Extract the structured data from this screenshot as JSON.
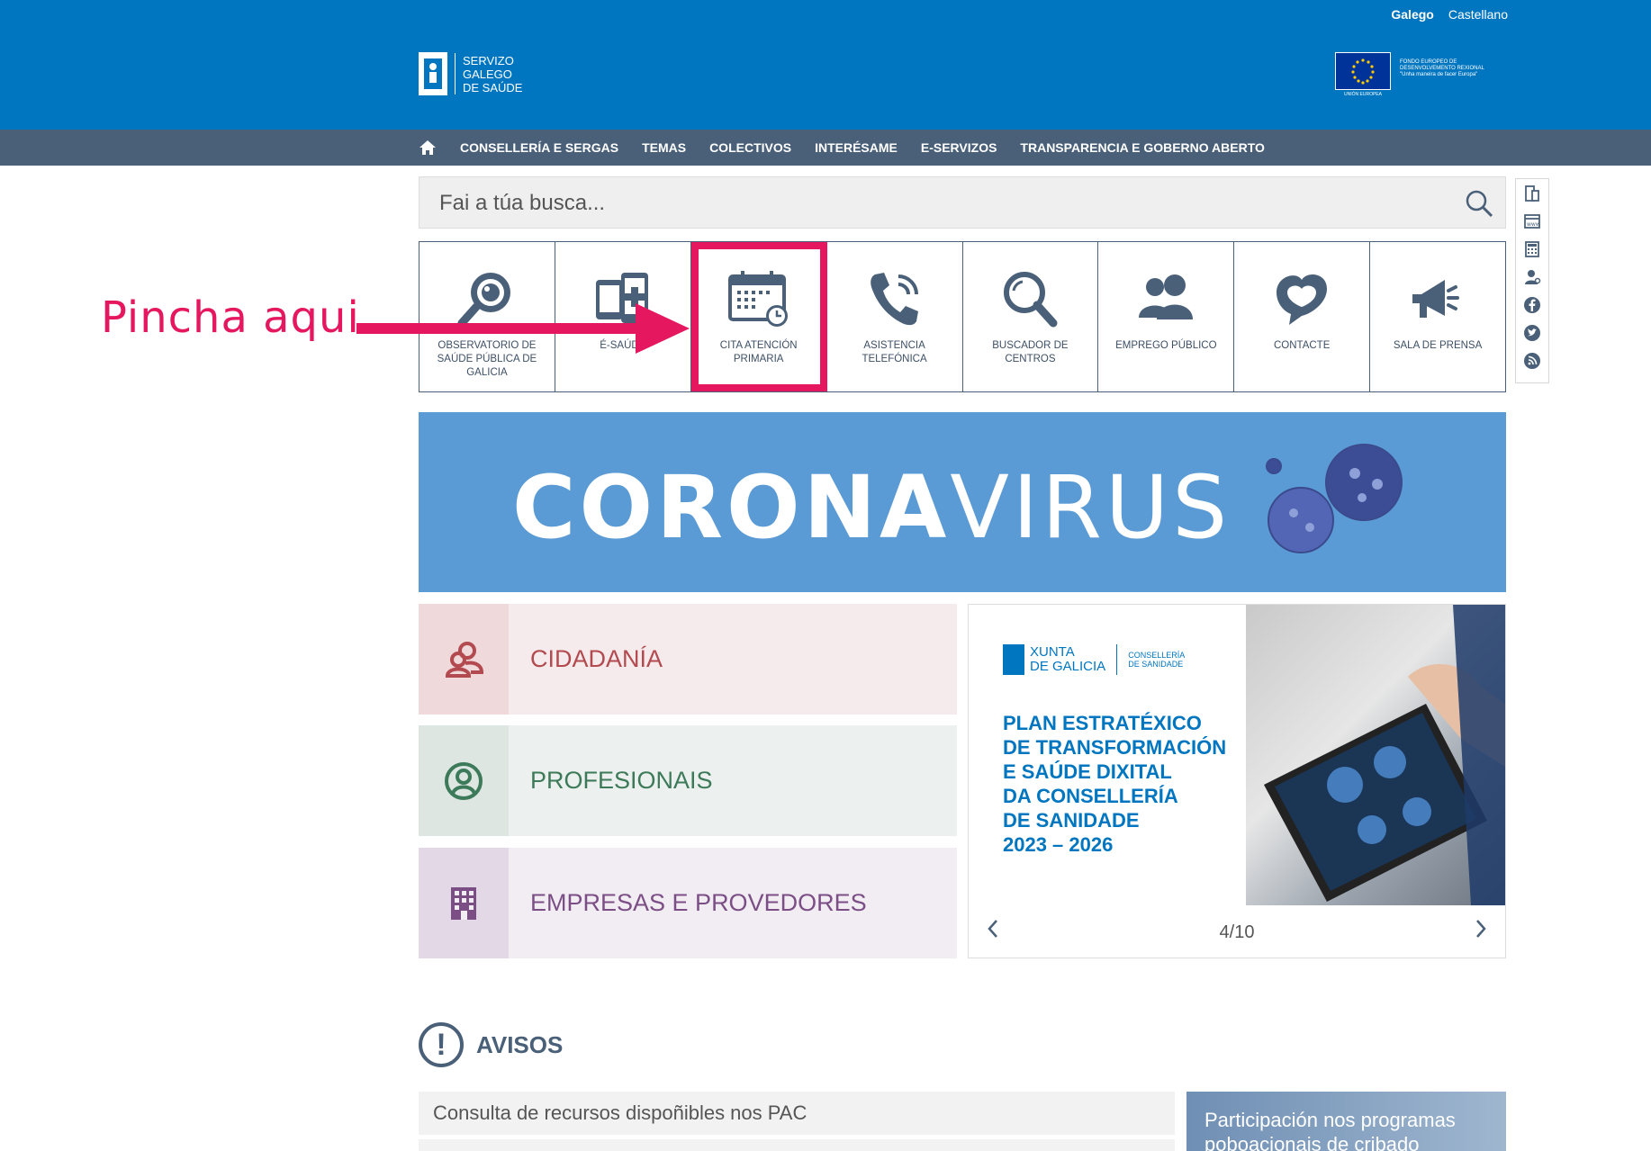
{
  "languages": [
    {
      "label": "Galego",
      "active": true
    },
    {
      "label": "Castellano",
      "active": false
    }
  ],
  "logo": {
    "line1": "SERVIZO",
    "line2": "GALEGO",
    "line3": "DE SAÚDE"
  },
  "eu": {
    "fund_line1": "FONDO EUROPEO DE",
    "fund_line2": "DESENVOLVEMENTO REXIONAL",
    "fund_line3": "\"Unha maneira de facer Europa\"",
    "flag_caption": "UNIÓN EUROPEA"
  },
  "nav": {
    "items": [
      "CONSELLERÍA E SERGAS",
      "TEMAS",
      "COLECTIVOS",
      "INTERÉSAME",
      "E-SERVIZOS",
      "TRANSPARENCIA E GOBERNO ABERTO"
    ]
  },
  "search": {
    "placeholder": "Fai a túa busca..."
  },
  "sidebar_icons": [
    "mobile-icon",
    "web-icon",
    "calculator-icon",
    "user-settings-icon",
    "facebook-icon",
    "twitter-icon",
    "rss-icon"
  ],
  "tiles": [
    {
      "label": "OBSERVATORIO DE SAÚDE PÚBLICA DE GALICIA",
      "icon": "magnifier-eye-icon"
    },
    {
      "label": "É-SAÚDE",
      "icon": "mobile-health-icon"
    },
    {
      "label": "CITA ATENCIÓN PRIMARIA",
      "icon": "calendar-clock-icon"
    },
    {
      "label": "ASISTENCIA TELEFÓNICA",
      "icon": "phone-icon"
    },
    {
      "label": "BUSCADOR DE CENTROS",
      "icon": "search-icon"
    },
    {
      "label": "EMPREGO PÚBLICO",
      "icon": "people-icon"
    },
    {
      "label": "CONTACTE",
      "icon": "heart-chat-icon"
    },
    {
      "label": "SALA DE PRENSA",
      "icon": "megaphone-icon"
    }
  ],
  "annotation": {
    "text": "Pincha aqui",
    "color": "#e5185f"
  },
  "banner": {
    "part1": "CORONA",
    "part2": "VIRUS"
  },
  "categories": [
    {
      "label": "CIDADANÍA"
    },
    {
      "label": "PROFESIONAIS"
    },
    {
      "label": "EMPRESAS E PROVEDORES"
    }
  ],
  "carousel": {
    "brand1": "XUNTA",
    "brand2": "DE GALICIA",
    "dept1": "CONSELLERÍA",
    "dept2": "DE SANIDADE",
    "plan_lines": [
      "PLAN ESTRATÉXICO",
      "DE TRANSFORMACIÓN",
      "E SAÚDE DIXITAL",
      "DA CONSELLERÍA",
      "DE SANIDADE",
      "2023 – 2026"
    ],
    "pager": "4/10"
  },
  "avisos": {
    "title": "AVISOS",
    "items": [
      "Consulta de recursos dispoñibles nos PAC"
    ],
    "promo": "Participación nos programas poboacionais de cribado"
  },
  "colors": {
    "header": "#0076c0",
    "nav": "#4a6079",
    "accent": "#e5185f"
  }
}
